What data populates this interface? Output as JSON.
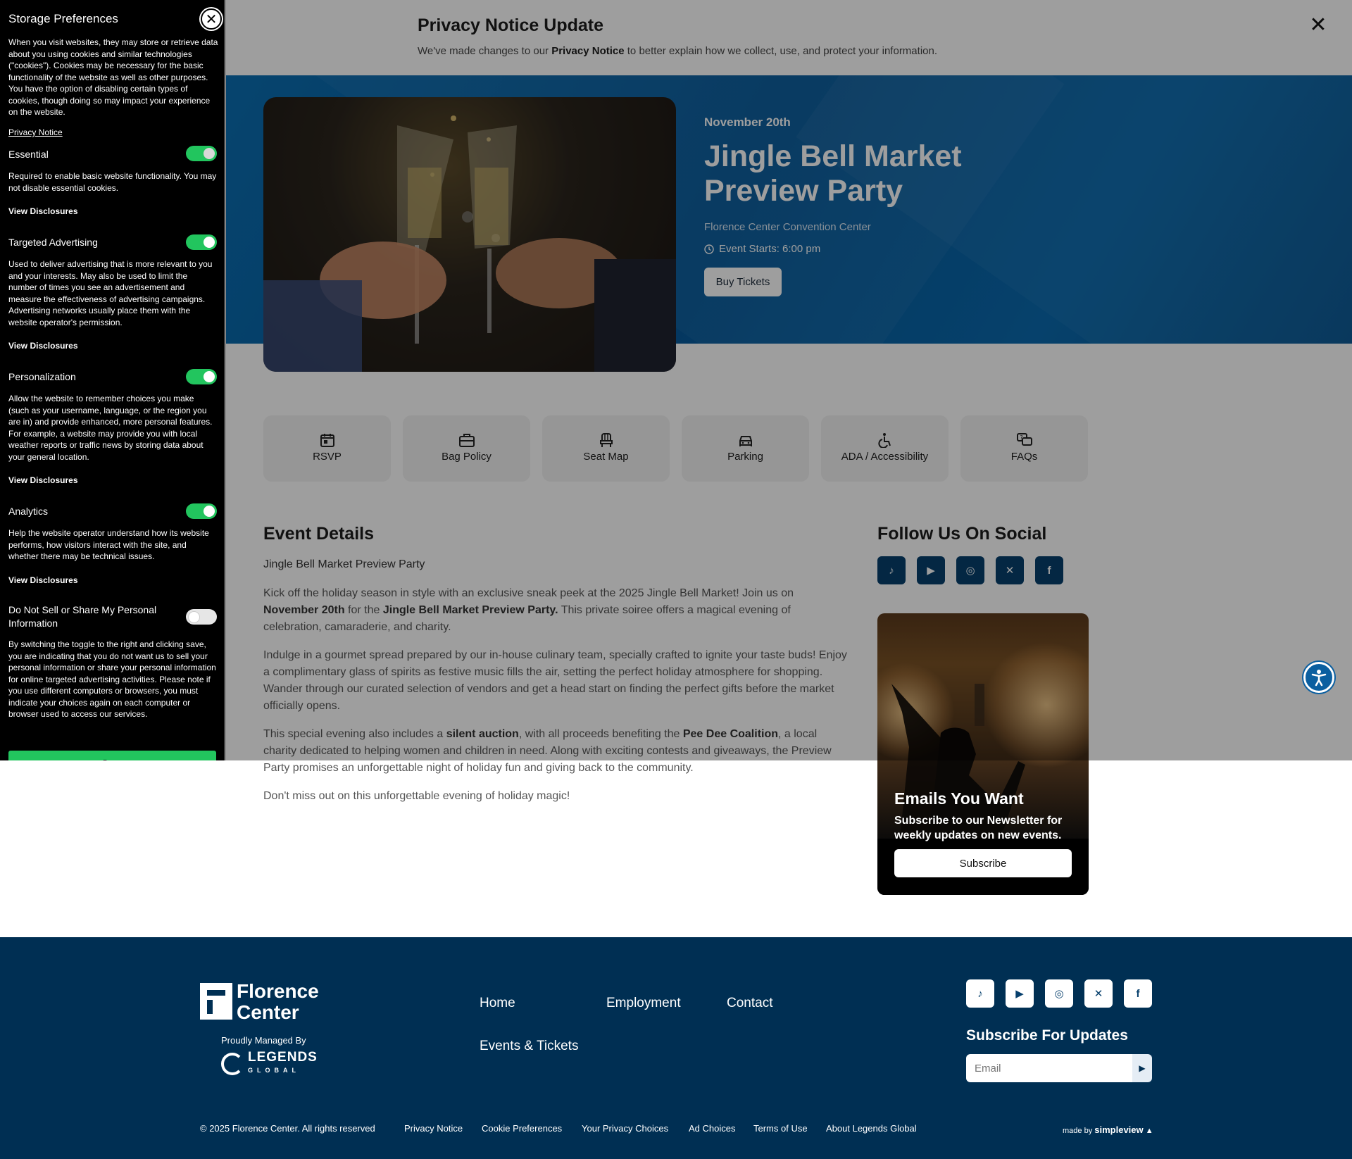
{
  "privacy_bar": {
    "title": "Privacy Notice Update",
    "text_before": "We've made changes to our ",
    "text_bold": "Privacy Notice",
    "text_after": " to better explain how we collect, use, and protect your information.",
    "close": "✕"
  },
  "hero": {
    "date": "November 20th",
    "title": "Jingle Bell Market Preview Party",
    "venue": "Florence Center Convention Center",
    "time": "Event Starts: 6:00 pm",
    "button": "Buy Tickets"
  },
  "quick_links": [
    "RSVP",
    "Bag Policy",
    "Seat Map",
    "Parking",
    "ADA / Accessibility",
    "FAQs"
  ],
  "details": {
    "heading": "Event Details",
    "subheading": "Jingle Bell Market Preview Party",
    "p1_a": "Kick off the holiday season in style with an exclusive sneak peek at the 2025 Jingle Bell Market! Join us on ",
    "p1_b": "November 20th",
    "p1_c": " for the ",
    "p1_d": "Jingle Bell Market Preview Party.",
    "p1_e": " This private soiree offers a magical evening of celebration, camaraderie, and charity.",
    "p2": "Indulge in a gourmet spread prepared by our in-house culinary team, specially crafted to ignite your taste buds! Enjoy a complimentary glass of spirits as festive music fills the air, setting the perfect holiday atmosphere for shopping. Wander through our curated selection of vendors and get a head start on finding the perfect gifts before the market officially opens.",
    "p3_a": "This special evening also includes a ",
    "p3_b": "silent auction",
    "p3_c": ", with all proceeds benefiting the ",
    "p3_d": "Pee Dee Coalition",
    "p3_e": ", a local charity dedicated to helping women and children in need. Along with exciting contests and giveaways, the Preview Party promises an unforgettable night of holiday fun and giving back to the community.",
    "p4": "Don't miss out on this unforgettable evening of holiday magic!"
  },
  "social": {
    "heading": "Follow Us On Social",
    "icons": [
      "tiktok-icon",
      "youtube-icon",
      "instagram-icon",
      "x-icon",
      "facebook-icon"
    ]
  },
  "promo": {
    "title": "Emails You Want",
    "text": "Subscribe to our Newsletter for weekly updates on new events.",
    "button": "Subscribe"
  },
  "footer": {
    "logo_line1": "Florence",
    "logo_line2": "Center",
    "managed_by": "Proudly Managed By",
    "legends_name": "LEGENDS",
    "legends_sub": "GLOBAL",
    "nav": [
      "Home",
      "Employment",
      "Contact",
      "Events & Tickets"
    ],
    "subscribe_heading": "Subscribe For Updates",
    "email_placeholder": "Email",
    "copyright": "© 2025 Florence Center. All rights reserved",
    "bottom_links": [
      "Privacy Notice",
      "Cookie Preferences",
      "Your Privacy Choices",
      "Ad Choices",
      "Terms of Use",
      "About Legends Global"
    ],
    "made_by": "made by",
    "made_by_brand": "simpleview"
  },
  "cookie_panel": {
    "title": "Storage Preferences",
    "intro": "When you visit websites, they may store or retrieve data about you using cookies and similar technologies (\"cookies\"). Cookies may be necessary for the basic functionality of the website as well as other purposes. You have the option of disabling certain types of cookies, though doing so may impact your experience on the website.",
    "privacy_link": "Privacy Notice",
    "view_disclosures": "View Disclosures",
    "categories": [
      {
        "title": "Essential",
        "desc": "Required to enable basic website functionality. You may not disable essential cookies.",
        "on": true
      },
      {
        "title": "Targeted Advertising",
        "desc": "Used to deliver advertising that is more relevant to you and your interests. May also be used to limit the number of times you see an advertisement and measure the effectiveness of advertising campaigns. Advertising networks usually place them with the website operator's permission.",
        "on": true
      },
      {
        "title": "Personalization",
        "desc": "Allow the website to remember choices you make (such as your username, language, or the region you are in) and provide enhanced, more personal features. For example, a website may provide you with local weather reports or traffic news by storing data about your general location.",
        "on": true
      },
      {
        "title": "Analytics",
        "desc": "Help the website operator understand how its website performs, how visitors interact with the site, and whether there may be technical issues.",
        "on": true
      },
      {
        "title": "Do Not Sell or Share My Personal Information",
        "desc": "By switching the toggle to the right and clicking save, you are indicating that you do not want us to sell your personal information or share your personal information for online targeted advertising activities. Please note if you use different computers or browsers, you must indicate your choices again on each computer or browser used to access our services.",
        "on": false
      }
    ],
    "save": "Save"
  },
  "colors": {
    "accent_green": "#22c55e",
    "hero_blue": "#07599b",
    "footer_navy": "#002f53"
  }
}
